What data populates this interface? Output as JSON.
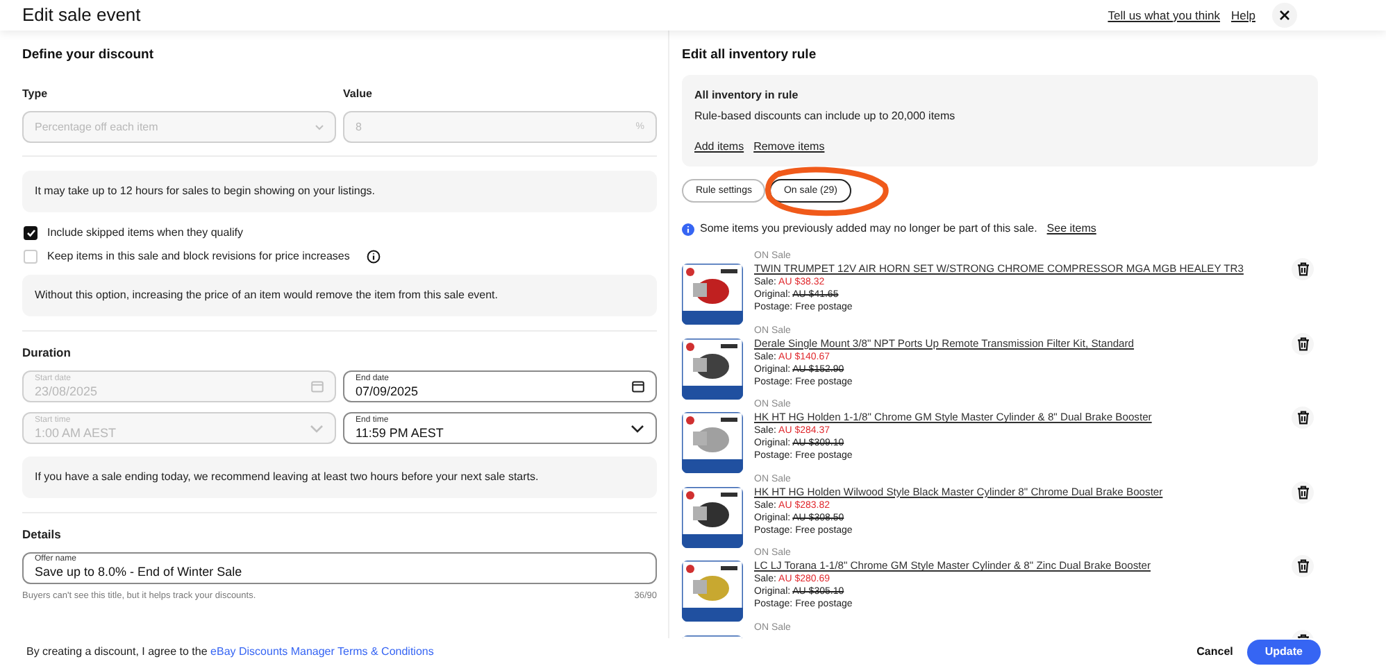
{
  "header": {
    "title": "Edit sale event",
    "links": [
      "Tell us what you think",
      "Help"
    ]
  },
  "discount": {
    "heading": "Define your discount",
    "type": {
      "label": "Type",
      "value": "Percentage off each item",
      "disabled": true
    },
    "value": {
      "label": "Value",
      "value": "8",
      "suffix": "%",
      "disabled": true
    },
    "notice": "It may take up to 12 hours for sales to begin showing on your listings.",
    "options": [
      {
        "label": "Include skipped items when they qualify",
        "checked": true,
        "info": false
      },
      {
        "label": "Keep items in this sale and block revisions for price increases",
        "checked": false,
        "info": true
      }
    ],
    "option_notice": "Without this option, increasing the price of an item would remove the item from this sale event."
  },
  "duration": {
    "heading": "Duration",
    "fields": [
      {
        "label": "Start date",
        "value": "23/08/2025",
        "kind": "date",
        "disabled": true
      },
      {
        "label": "End date",
        "value": "07/09/2025",
        "kind": "date",
        "disabled": false
      },
      {
        "label": "Start time",
        "value": "1:00 AM AEST",
        "kind": "time",
        "disabled": true
      },
      {
        "label": "End time",
        "value": "11:59 PM AEST",
        "kind": "time",
        "disabled": false
      }
    ],
    "notice": "If you have a sale ending today, we recommend leaving at least two hours before your next sale starts."
  },
  "details": {
    "heading": "Details",
    "offer_name": {
      "label": "Offer name",
      "value": "Save up to 8.0% - End of Winter Sale"
    },
    "helper": "Buyers can't see this title, but it helps track your discounts.",
    "count": "36/90"
  },
  "rule": {
    "heading": "Edit all inventory rule",
    "box_title": "All inventory in rule",
    "box_text": "Rule-based discounts can include up to 20,000 items",
    "links": [
      "Add items",
      "Remove items"
    ],
    "tabs": [
      {
        "label": "Rule settings",
        "selected": false
      },
      {
        "label": "On sale (29)",
        "selected": true
      }
    ],
    "info": "Some items you previously added may no longer be part of this sale.",
    "info_link": "See items",
    "items": [
      {
        "status": "ON Sale",
        "title": "TWIN TRUMPET 12V AIR HORN SET W/STRONG CHROME COMPRESSOR MGA MGB HEALEY TR3",
        "sale_label": "Sale:",
        "sale_price": "AU $38.32",
        "original_label": "Original:",
        "original_price": "AU $41.65",
        "postage": "Postage: Free postage"
      },
      {
        "status": "ON Sale",
        "title": "Derale Single Mount 3/8\" NPT Ports Up Remote Transmission Filter Kit, Standard",
        "sale_label": "Sale:",
        "sale_price": "AU $140.67",
        "original_label": "Original:",
        "original_price": "AU $152.90",
        "postage": "Postage: Free postage"
      },
      {
        "status": "ON Sale",
        "title": "HK HT HG Holden 1-1/8\" Chrome GM Style Master Cylinder & 8\" Dual Brake Booster",
        "sale_label": "Sale:",
        "sale_price": "AU $284.37",
        "original_label": "Original:",
        "original_price": "AU $309.10",
        "postage": "Postage: Free postage"
      },
      {
        "status": "ON Sale",
        "title": "HK HT HG Holden Wilwood Style Black Master Cylinder 8\" Chrome Dual Brake Booster",
        "sale_label": "Sale:",
        "sale_price": "AU $283.82",
        "original_label": "Original:",
        "original_price": "AU $308.50",
        "postage": "Postage: Free postage"
      },
      {
        "status": "ON Sale",
        "title": "LC LJ Torana 1-1/8\" Chrome GM Style Master Cylinder & 8\" Zinc Dual Brake Booster",
        "sale_label": "Sale:",
        "sale_price": "AU $280.69",
        "original_label": "Original:",
        "original_price": "AU $305.10",
        "postage": "Postage: Free postage"
      },
      {
        "status": "ON Sale"
      }
    ]
  },
  "footer": {
    "text": "By creating a discount, I agree to the ",
    "link": "eBay Discounts Manager Terms & Conditions",
    "buttons": [
      {
        "label": "Cancel",
        "kind": "secondary"
      },
      {
        "label": "Update",
        "kind": "primary"
      }
    ]
  }
}
